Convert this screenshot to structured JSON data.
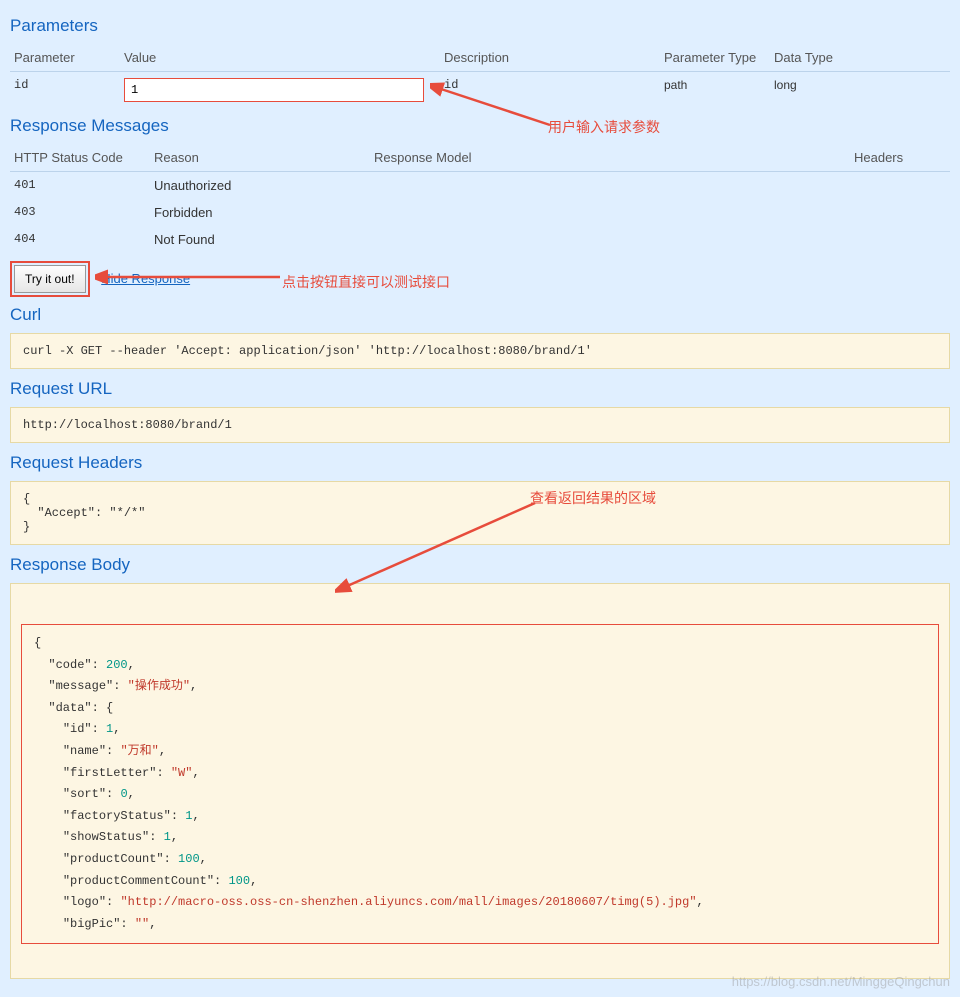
{
  "sections": {
    "parameters_title": "Parameters",
    "response_messages_title": "Response Messages",
    "curl_title": "Curl",
    "request_url_title": "Request URL",
    "request_headers_title": "Request Headers",
    "response_body_title": "Response Body"
  },
  "params_header": {
    "parameter": "Parameter",
    "value": "Value",
    "description": "Description",
    "param_type": "Parameter Type",
    "data_type": "Data Type"
  },
  "parameters": [
    {
      "name": "id",
      "value": "1",
      "description": "id",
      "paramType": "path",
      "dataType": "long"
    }
  ],
  "resp_header": {
    "code": "HTTP Status Code",
    "reason": "Reason",
    "model": "Response Model",
    "headers": "Headers"
  },
  "response_messages": [
    {
      "code": "401",
      "reason": "Unauthorized"
    },
    {
      "code": "403",
      "reason": "Forbidden"
    },
    {
      "code": "404",
      "reason": "Not Found"
    }
  ],
  "try_button": "Try it out!",
  "hide_response": "Hide Response",
  "curl": "curl -X GET --header 'Accept: application/json' 'http://localhost:8080/brand/1'",
  "request_url": "http://localhost:8080/brand/1",
  "request_headers": "{\n  \"Accept\": \"*/*\"\n}",
  "response_body": {
    "code": 200,
    "message": "操作成功",
    "data": {
      "id": 1,
      "name": "万和",
      "firstLetter": "W",
      "sort": 0,
      "factoryStatus": 1,
      "showStatus": 1,
      "productCount": 100,
      "productCommentCount": 100,
      "logo": "http://macro-oss.oss-cn-shenzhen.aliyuncs.com/mall/images/20180607/timg(5).jpg",
      "bigPic": ""
    }
  },
  "annotations": {
    "input_param": "用户输入请求参数",
    "click_test": "点击按钮直接可以测试接口",
    "view_result": "查看返回结果的区域"
  },
  "watermark": "https://blog.csdn.net/MinggeQingchun"
}
